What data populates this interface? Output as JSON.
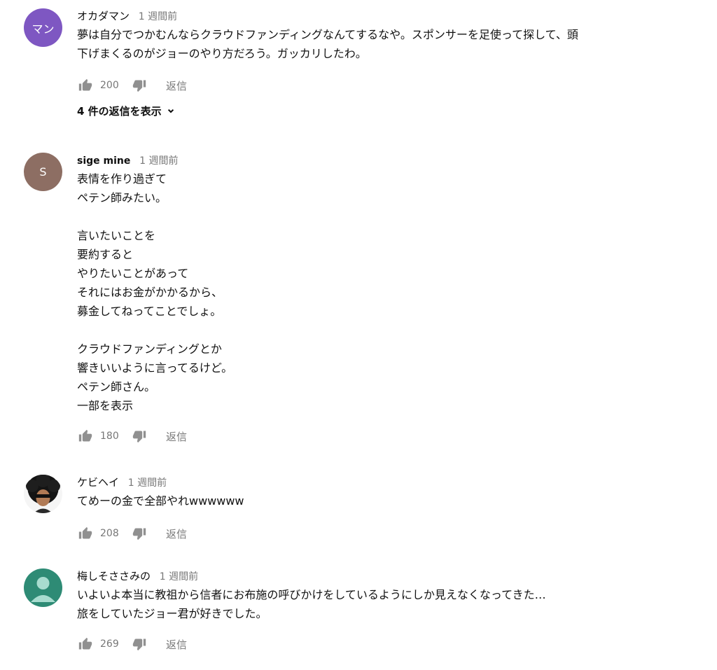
{
  "comments": [
    {
      "author": "オカダマン",
      "avatar_text": "マン",
      "avatar_color": "#7e57c2",
      "time": "1 週間前",
      "text": "夢は自分でつかむんならクラウドファンディングなんてするなや。スポンサーを足使って探して、頭\n下げまくるのがジョーのやり方だろう。ガッカリしたわ。",
      "likes": "200",
      "reply_label": "返信",
      "replies_label": "4 件の返信を表示"
    },
    {
      "author": "sige mine",
      "avatar_text": "S",
      "avatar_color": "#8d6e63",
      "time": "1 週間前",
      "text": "表情を作り過ぎて\nペテン師みたい。\n\n言いたいことを\n要約すると\nやりたいことがあって\nそれにはお金がかかるから、\n募金してねってことでしょ。\n\nクラウドファンディングとか\n響きいいように言ってるけど。\nペテン師さん。",
      "read_more": "一部を表示",
      "likes": "180",
      "reply_label": "返信"
    },
    {
      "author": "ケビヘイ",
      "avatar_color": "#f5f5f5",
      "time": "1 週間前",
      "text": "てめーの金で全部やれwwwwww",
      "likes": "208",
      "reply_label": "返信"
    },
    {
      "author": "梅しそささみの",
      "avatar_color": "#2e8b75",
      "time": "1 週間前",
      "text": "いよいよ本当に教祖から信者にお布施の呼びかけをしているようにしか見えなくなってきた…\n旅をしていたジョー君が好きでした。",
      "likes": "269",
      "reply_label": "返信"
    }
  ],
  "icons": {
    "like": "thumbs-up-icon",
    "dislike": "thumbs-down-icon",
    "expand": "chevron-down-icon",
    "icon_color": "#909090"
  }
}
